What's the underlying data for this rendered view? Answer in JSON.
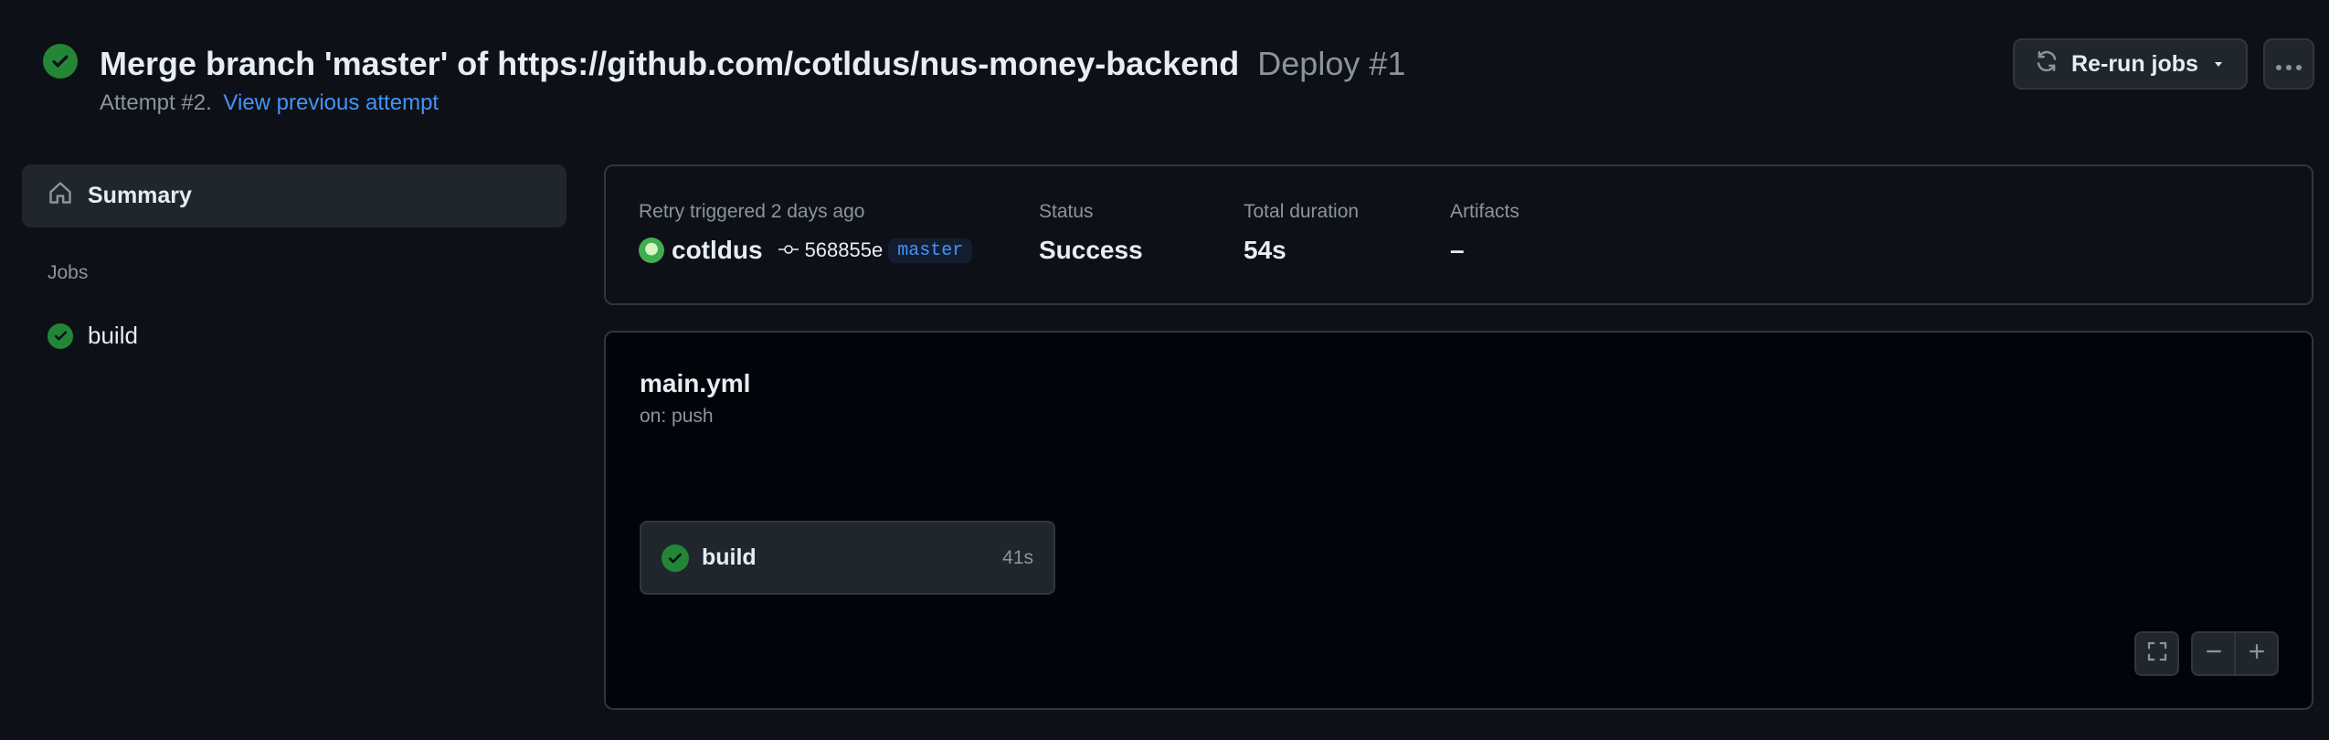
{
  "header": {
    "title": "Merge branch 'master' of https://github.com/cotldus/nus-money-backend",
    "workflow_run": "Deploy #1",
    "attempt_text": "Attempt #2.",
    "previous_attempt_link": "View previous attempt",
    "rerun_label": "Re-run jobs",
    "status_icon": "check-circle-fill-icon"
  },
  "sidebar": {
    "summary_label": "Summary",
    "jobs_heading": "Jobs",
    "jobs": [
      {
        "label": "build",
        "status": "success"
      }
    ]
  },
  "info": {
    "trigger_label": "Retry triggered 2 days ago",
    "actor": "cotldus",
    "commit_sha": "568855e",
    "branch": "master",
    "status_label": "Status",
    "status_value": "Success",
    "duration_label": "Total duration",
    "duration_value": "54s",
    "artifacts_label": "Artifacts",
    "artifacts_value": "–"
  },
  "workflow": {
    "file": "main.yml",
    "trigger": "on: push",
    "jobs": [
      {
        "name": "build",
        "duration": "41s",
        "status": "success"
      }
    ]
  },
  "colors": {
    "background": "#0d1117",
    "success": "#238636",
    "link": "#4493f8",
    "border": "#30363d",
    "muted": "#8b949e"
  }
}
